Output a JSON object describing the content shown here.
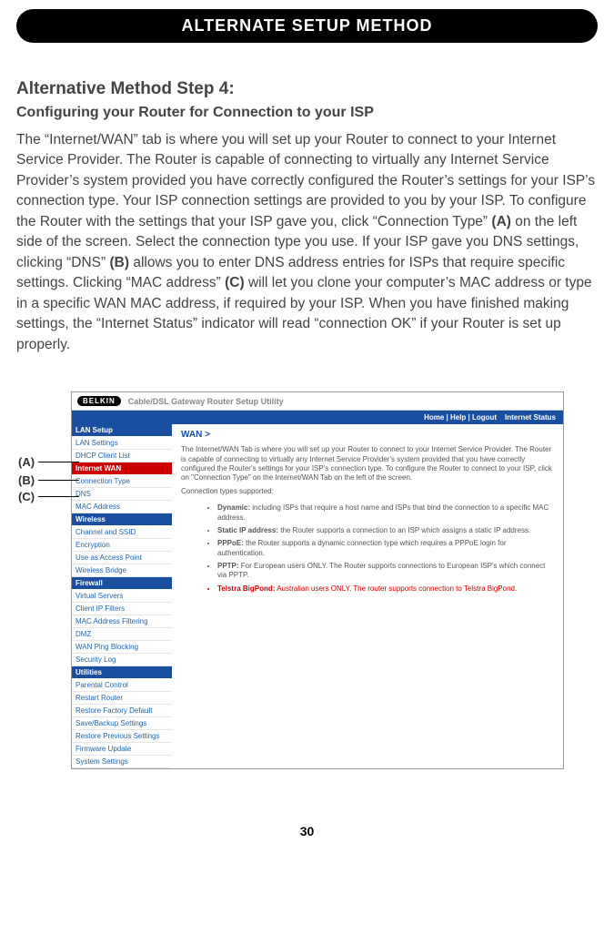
{
  "banner": "ALTERNATE SETUP METHOD",
  "step_title": "Alternative Method Step 4:",
  "sub_title": "Configuring your Router for Connection to your ISP",
  "body_html": "The “Internet/WAN” tab is where you will set up your Router to connect to your Internet Service Provider. The Router is capable of connecting to virtually any Internet Service Provider’s system provided you have correctly configured the Router’s settings for your ISP’s connection type. Your ISP connection settings are provided to you by your ISP. To configure the Router with the settings that your ISP gave you, click “Connection Type” <b>(A)</b> on the left side of the screen. Select the connection type you use. If your ISP gave you DNS settings, clicking “DNS” <b>(B)</b> allows you to enter DNS address entries for ISPs that require specific settings. Clicking “MAC address” <b>(C)</b> will let you clone your computer’s MAC address or type in a specific WAN MAC address, if required by your ISP. When you have finished making settings, the “Internet Status” indicator will read “connection OK” if your Router is set up properly.",
  "callouts": {
    "a": "(A)",
    "b": "(B)",
    "c": "(C)"
  },
  "page_number": "30",
  "screenshot": {
    "logo": "BELKIN",
    "window_title": "Cable/DSL Gateway Router Setup Utility",
    "nav": "Home | Help | Logout    Internet Status",
    "sidebar": {
      "lan_setup": "LAN Setup",
      "lan_settings": "LAN Settings",
      "dhcp": "DHCP Client List",
      "internet_wan": "Internet WAN",
      "conn_type": "Connection Type",
      "dns": "DNS",
      "mac": "MAC Address",
      "wireless": "Wireless",
      "channel": "Channel and SSID",
      "encryption": "Encryption",
      "uap": "Use as Access Point",
      "bridge": "Wireless Bridge",
      "firewall": "Firewall",
      "vservers": "Virtual Servers",
      "ipfilter": "Client IP Filters",
      "macfilter": "MAC Address Filtering",
      "dmz": "DMZ",
      "ping": "WAN Ping Blocking",
      "seclog": "Security Log",
      "utilities": "Utilities",
      "parental": "Parental Control",
      "restart": "Restart Router",
      "factory": "Restore Factory Default",
      "backup": "Save/Backup Settings",
      "restore_prev": "Restore Previous Settings",
      "firmware": "Firmware Update",
      "system": "System Settings"
    },
    "content": {
      "heading": "WAN >",
      "intro": "The Internet/WAN Tab is where you will set up your Router to connect to your Internet Service Provider. The Router is capable of connecting to virtually any Internet Service Provider's system provided that you have correctly configured the Router's settings for your ISP's connection type. To configure the Router to connect to your ISP, click on \"Connection Type\" on the Internet/WAN Tab on the left of the screen.",
      "supported": "Connection types supported:",
      "b1_label": "Dynamic:",
      "b1": "including ISPs that require a host name and ISPs that bind the connection to a specific MAC address.",
      "b2_label": "Static IP address:",
      "b2": "the Router supports a connection to an ISP which assigns a static IP address.",
      "b3_label": "PPPoE:",
      "b3": "the Router supports a dynamic connection type which requires a PPPoE login for authentication.",
      "b4_label": "PPTP:",
      "b4": "For European users ONLY. The Router supports connections to European ISP's which connect via PPTP.",
      "b5_label": "Telstra BigPond:",
      "b5": "Australian users ONLY. The router supports connection to Telstra BigPond."
    }
  }
}
